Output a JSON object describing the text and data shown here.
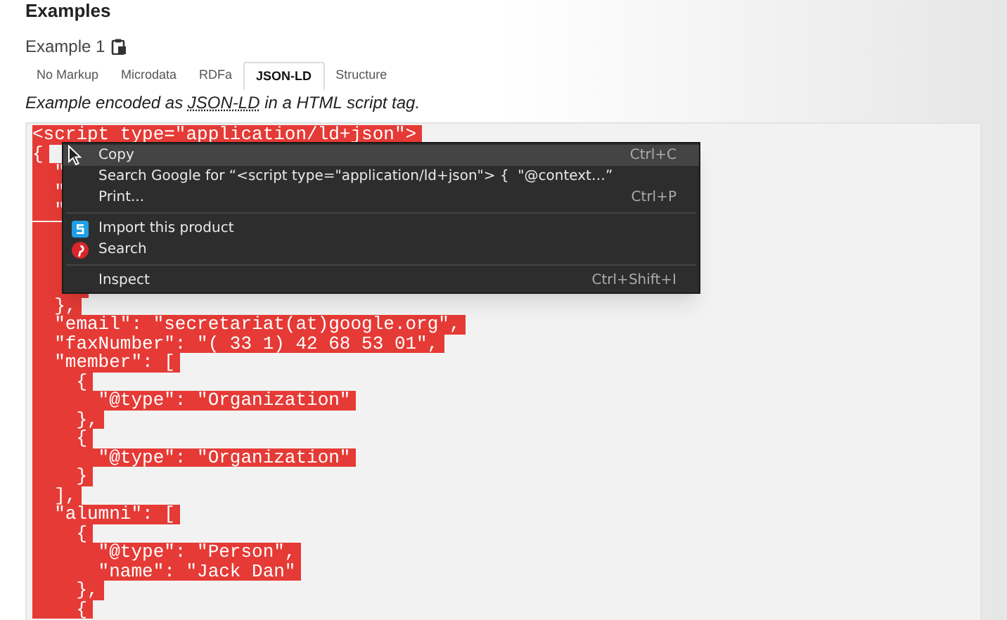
{
  "section_title": "Examples",
  "example": {
    "title": "Example 1"
  },
  "tabs": [
    {
      "label": "No Markup",
      "selected": false
    },
    {
      "label": "Microdata",
      "selected": false
    },
    {
      "label": "RDFa",
      "selected": false
    },
    {
      "label": "JSON-LD",
      "selected": true
    },
    {
      "label": "Structure",
      "selected": false
    }
  ],
  "description": {
    "before": "Example encoded as ",
    "link": "JSON-LD",
    "after": " in a HTML script tag."
  },
  "code_lines": [
    {
      "kind": "text",
      "text": "<script type=\"application/ld+json\">"
    },
    {
      "kind": "text",
      "text": "{"
    },
    {
      "kind": "text",
      "text": "  \""
    },
    {
      "kind": "text",
      "text": "  \""
    },
    {
      "kind": "text",
      "text": "  \""
    },
    {
      "kind": "covered"
    },
    {
      "kind": "covered"
    },
    {
      "kind": "covered"
    },
    {
      "kind": "covered"
    },
    {
      "kind": "text",
      "text": "  },"
    },
    {
      "kind": "text",
      "text": "  \"email\": \"secretariat(at)google.org\","
    },
    {
      "kind": "text",
      "text": "  \"faxNumber\": \"( 33 1) 42 68 53 01\","
    },
    {
      "kind": "text",
      "text": "  \"member\": ["
    },
    {
      "kind": "text",
      "text": "    {"
    },
    {
      "kind": "text",
      "text": "      \"@type\": \"Organization\""
    },
    {
      "kind": "text",
      "text": "    },"
    },
    {
      "kind": "text",
      "text": "    {"
    },
    {
      "kind": "text",
      "text": "      \"@type\": \"Organization\""
    },
    {
      "kind": "text",
      "text": "    }"
    },
    {
      "kind": "text",
      "text": "  ],"
    },
    {
      "kind": "text",
      "text": "  \"alumni\": ["
    },
    {
      "kind": "text",
      "text": "    {"
    },
    {
      "kind": "text",
      "text": "      \"@type\": \"Person\","
    },
    {
      "kind": "text",
      "text": "      \"name\": \"Jack Dan\""
    },
    {
      "kind": "text",
      "text": "    },"
    },
    {
      "kind": "text",
      "text": "    {"
    }
  ],
  "context_menu": [
    {
      "kind": "item",
      "label": "Copy",
      "shortcut": "Ctrl+C",
      "selected": true
    },
    {
      "kind": "item",
      "label": "Search Google for “<script type=\"application/ld+json\"> {  \"@context…”",
      "selected": false
    },
    {
      "kind": "item",
      "label": "Print...",
      "shortcut": "Ctrl+P",
      "selected": false
    },
    {
      "kind": "separator"
    },
    {
      "kind": "app_item",
      "label": "Import this product",
      "selected": false
    },
    {
      "kind": "pin_item",
      "label": "Search",
      "selected": false
    },
    {
      "kind": "separator"
    },
    {
      "kind": "item",
      "label": "Inspect",
      "shortcut": "Ctrl+Shift+I",
      "selected": false
    }
  ]
}
